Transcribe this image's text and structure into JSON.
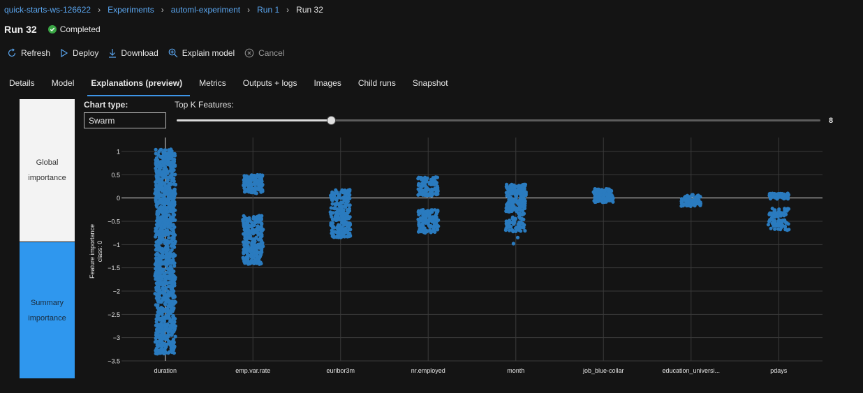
{
  "breadcrumb": [
    "quick-starts-ws-126622",
    "Experiments",
    "automl-experiment",
    "Run 1",
    "Run 32"
  ],
  "run": {
    "title": "Run 32",
    "status": "Completed"
  },
  "toolbar": {
    "refresh": "Refresh",
    "deploy": "Deploy",
    "download": "Download",
    "explain": "Explain model",
    "cancel": "Cancel"
  },
  "tabs": [
    "Details",
    "Model",
    "Explanations (preview)",
    "Metrics",
    "Outputs + logs",
    "Images",
    "Child runs",
    "Snapshot"
  ],
  "active_tab": "Explanations (preview)",
  "side": {
    "global": {
      "line1": "Global",
      "line2": "importance"
    },
    "summary": {
      "line1": "Summary",
      "line2": "importance"
    }
  },
  "controls": {
    "chart_type_label": "Chart type:",
    "chart_type_value": "Swarm",
    "topk_label": "Top K Features:",
    "topk_value": "8",
    "topk_fraction": 0.24
  },
  "colors": {
    "accent": "#2f97ee",
    "point": "#2a7bbf",
    "status_ok": "#3aa645",
    "link": "#5aa5ee"
  },
  "chart_data": {
    "type": "scatter",
    "subtype": "swarm",
    "ylabel_line1": "Feature importance",
    "ylabel_line2": "class: 0",
    "ylim": [
      -3.5,
      1
    ],
    "yticks": [
      1,
      0.5,
      0,
      -0.5,
      -1,
      -1.5,
      -2,
      -2.5,
      -3,
      -3.5
    ],
    "ytick_labels": [
      "1",
      "0.5",
      "0",
      "−0.5",
      "−1",
      "−1.5",
      "−2",
      "−2.5",
      "−3",
      "−3.5"
    ],
    "categories": [
      "duration",
      "emp.var.rate",
      "euribor3m",
      "nr.employed",
      "month",
      "job_blue-collar",
      "education_universi...",
      "pdays"
    ],
    "series": [
      {
        "clusters": [
          [
            -3.35,
            1.05,
            1100
          ]
        ],
        "outliers": []
      },
      {
        "clusters": [
          [
            0.1,
            0.5,
            130
          ],
          [
            -1.42,
            -0.38,
            260
          ]
        ],
        "outliers": []
      },
      {
        "clusters": [
          [
            -0.85,
            0.18,
            240
          ]
        ],
        "outliers": []
      },
      {
        "clusters": [
          [
            0.05,
            0.45,
            120
          ],
          [
            -0.75,
            -0.25,
            140
          ]
        ],
        "outliers": []
      },
      {
        "clusters": [
          [
            -0.3,
            0.3,
            200
          ],
          [
            -0.72,
            -0.3,
            60
          ]
        ],
        "outliers": [
          -0.85,
          -0.98
        ]
      },
      {
        "clusters": [
          [
            -0.1,
            0.2,
            110
          ]
        ],
        "outliers": []
      },
      {
        "clusters": [
          [
            -0.18,
            0.07,
            80
          ]
        ],
        "outliers": []
      },
      {
        "clusters": [
          [
            -0.02,
            0.1,
            70
          ],
          [
            -0.7,
            -0.22,
            90
          ]
        ],
        "outliers": []
      }
    ],
    "grid": true
  }
}
